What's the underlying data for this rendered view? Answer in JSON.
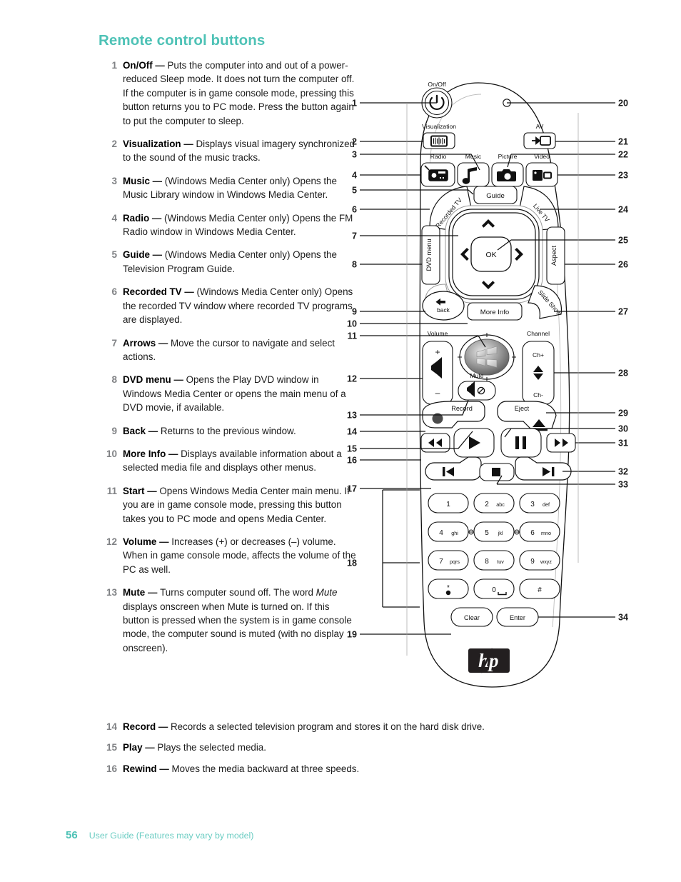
{
  "page": {
    "heading": "Remote control buttons",
    "number": "56",
    "footer_text": "User Guide (Features may vary by model)",
    "accent_color": "#4ec2b6",
    "num_color": "#808285"
  },
  "items": [
    {
      "num": "1",
      "term": "On/Off",
      "dash": "—",
      "desc": "Puts the computer into and out of a power-reduced Sleep mode. It does not turn the computer off. If the computer is in game console mode, pressing this button returns you to PC mode. Press the button again to put the computer to sleep."
    },
    {
      "num": "2",
      "term": "Visualization",
      "dash": "—",
      "desc": "Displays visual imagery synchronized to the sound of the music tracks."
    },
    {
      "num": "3",
      "term": "Music",
      "dash": "—",
      "desc": "(Windows Media Center only) Opens the Music Library window in Windows Media Center."
    },
    {
      "num": "4",
      "term": "Radio",
      "dash": "—",
      "desc": "(Windows Media Center only) Opens the FM Radio window in Windows Media Center."
    },
    {
      "num": "5",
      "term": "Guide",
      "dash": "—",
      "desc": "(Windows Media Center only) Opens the Television Program Guide."
    },
    {
      "num": "6",
      "term": "Recorded TV",
      "dash": "—",
      "desc": "(Windows Media Center only) Opens the recorded TV window where recorded TV programs are displayed."
    },
    {
      "num": "7",
      "term": "Arrows",
      "dash": "—",
      "desc": "Move the cursor to navigate and select actions."
    },
    {
      "num": "8",
      "term": "DVD menu",
      "dash": "—",
      "desc": "Opens the Play DVD window in Windows Media Center or opens the main menu of a DVD movie, if available."
    },
    {
      "num": "9",
      "term": "Back",
      "dash": "—",
      "desc": "Returns to the previous window."
    },
    {
      "num": "10",
      "term": "More Info",
      "dash": "—",
      "desc": "Displays available information about a selected media file and displays other menus."
    },
    {
      "num": "11",
      "term": "Start",
      "dash": "—",
      "desc": "Opens Windows Media Center main menu. If you are in game console mode, pressing this button takes you to PC mode and opens Media Center."
    },
    {
      "num": "12",
      "term": "Volume",
      "dash": "—",
      "desc": "Increases (+) or decreases (–) volume. When in game console mode, affects the volume of the PC as well."
    },
    {
      "num": "13",
      "term": "Mute",
      "dash": "—",
      "desc": "Turns computer sound off. The word Mute displays onscreen when Mute is turned on. If this button is pressed when the system is in game console mode, the computer sound is muted (with no display onscreen)."
    }
  ],
  "items_wide": [
    {
      "num": "14",
      "term": "Record",
      "dash": "—",
      "desc": "Records a selected television program and stores it on the hard disk drive."
    },
    {
      "num": "15",
      "term": "Play",
      "dash": "—",
      "desc": "Plays the selected media."
    },
    {
      "num": "16",
      "term": "Rewind",
      "dash": "—",
      "desc": "Moves the media backward at three speeds."
    }
  ],
  "figure": {
    "brand": "hp",
    "labels": {
      "on_off": "On/Off",
      "visualization": "Visualization",
      "radio": "Radio",
      "music": "Music",
      "picture": "Picture",
      "video": "Video",
      "av": "AV",
      "recorded_tv": "Recorded TV",
      "guide": "Guide",
      "live_tv": "Live TV",
      "dvd_menu": "DVD menu",
      "ok": "OK",
      "aspect": "Aspect",
      "back": "back",
      "more_info": "More Info",
      "slide_show": "Slide Show",
      "volume": "Volume",
      "mute": "Mute",
      "channel": "Channel",
      "ch_plus": "Ch+",
      "ch_minus": "Ch-",
      "plus": "+",
      "minus": "–",
      "record": "Record",
      "eject": "Eject",
      "clear": "Clear",
      "enter": "Enter"
    },
    "keypad": [
      {
        "digit": "1",
        "letters": ""
      },
      {
        "digit": "2",
        "letters": "abc"
      },
      {
        "digit": "3",
        "letters": "def"
      },
      {
        "digit": "4",
        "letters": "ghi"
      },
      {
        "digit": "5",
        "letters": "jkl"
      },
      {
        "digit": "6",
        "letters": "mno"
      },
      {
        "digit": "7",
        "letters": "pqrs"
      },
      {
        "digit": "8",
        "letters": "tuv"
      },
      {
        "digit": "9",
        "letters": "wxyz"
      },
      {
        "digit": "*",
        "letters": ""
      },
      {
        "digit": "0",
        "letters": ""
      },
      {
        "digit": "#",
        "letters": ""
      }
    ],
    "callouts_left": [
      "1",
      "2",
      "3",
      "4",
      "5",
      "6",
      "7",
      "8",
      "9",
      "10",
      "11",
      "12",
      "13",
      "14",
      "15",
      "16",
      "17",
      "18",
      "19"
    ],
    "callouts_right": [
      "20",
      "21",
      "22",
      "23",
      "24",
      "25",
      "26",
      "27",
      "28",
      "29",
      "30",
      "31",
      "32",
      "33",
      "34"
    ]
  }
}
